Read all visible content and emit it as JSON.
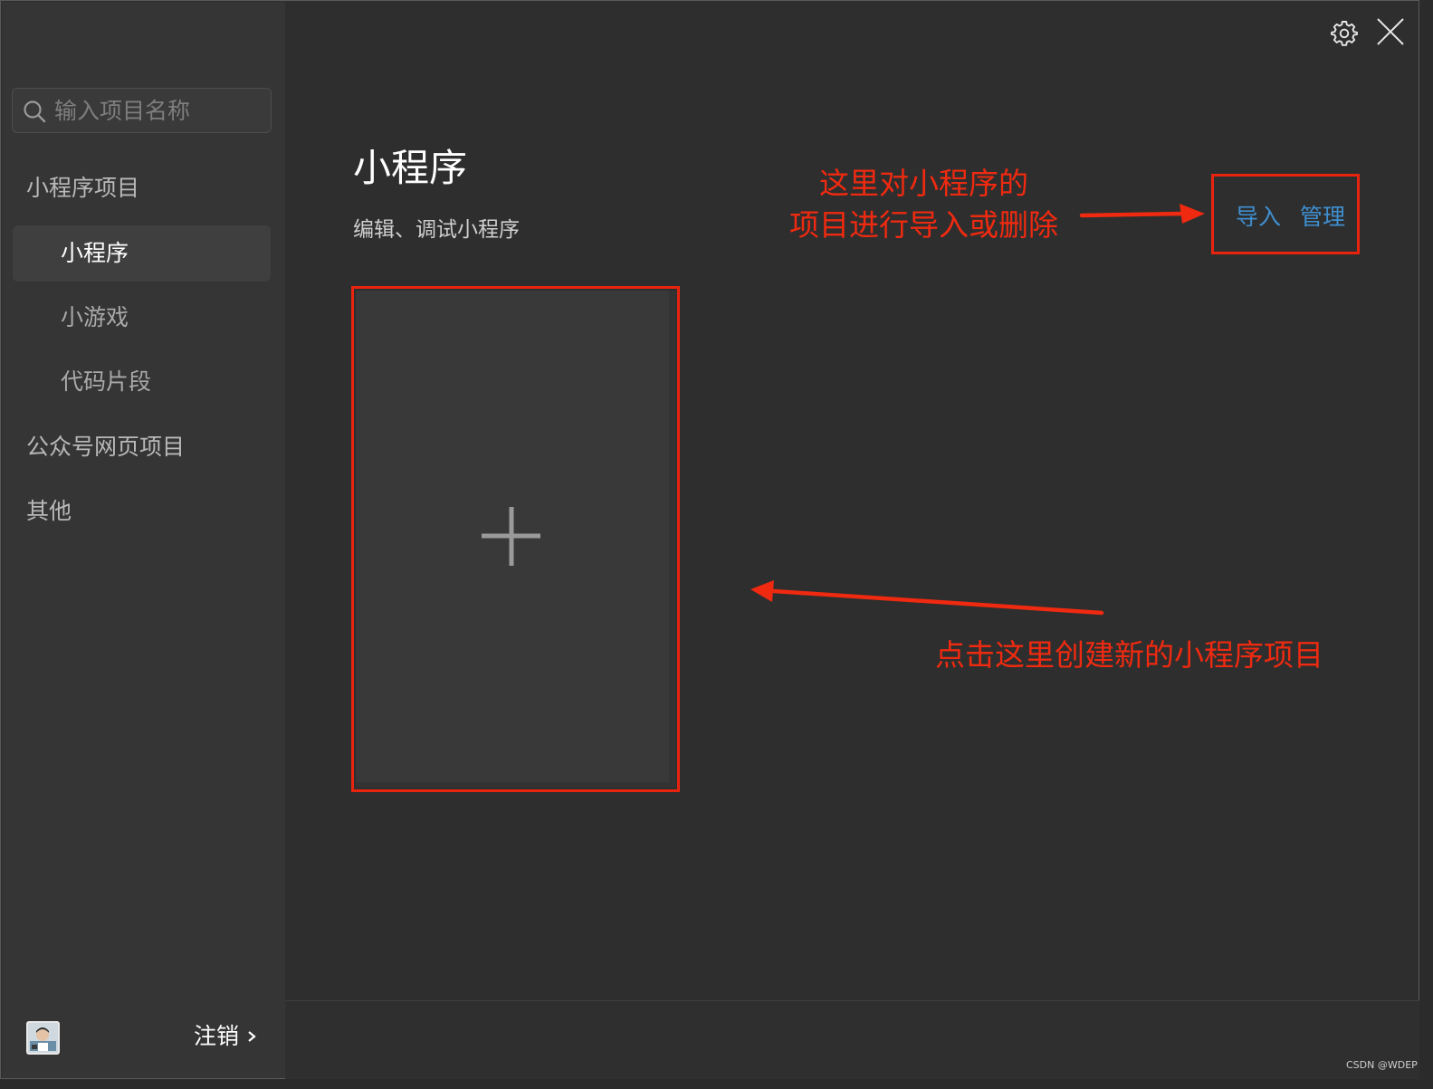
{
  "search": {
    "placeholder": "输入项目名称"
  },
  "sidebar": {
    "groups": [
      {
        "label": "小程序项目"
      },
      {
        "label": "公众号网页项目"
      },
      {
        "label": "其他"
      }
    ],
    "items": [
      {
        "label": "小程序",
        "active": true
      },
      {
        "label": "小游戏",
        "active": false
      },
      {
        "label": "代码片段",
        "active": false
      }
    ]
  },
  "footer": {
    "logout_label": "注销"
  },
  "main": {
    "title": "小程序",
    "subtitle": "编辑、调试小程序",
    "actions": {
      "import_label": "导入",
      "manage_label": "管理"
    }
  },
  "annotations": {
    "top_line1": "这里对小程序的",
    "top_line2": "项目进行导入或删除",
    "bottom": "点击这里创建新的小程序项目"
  },
  "watermark": "CSDN @WDEP",
  "colors": {
    "background": "#2e2e2e",
    "sidebar": "#353535",
    "link": "#3f8fd0",
    "annotation": "#ef2a10"
  },
  "icons": [
    "search-icon",
    "gear-icon",
    "close-icon",
    "plus-icon",
    "chevron-right-icon"
  ]
}
